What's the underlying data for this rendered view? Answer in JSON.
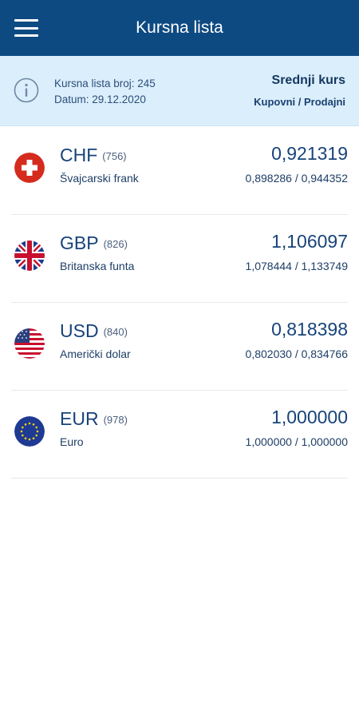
{
  "header": {
    "title": "Kursna lista"
  },
  "info": {
    "list_number": "Kursna lista broj: 245",
    "date": "Datum: 29.12.2020",
    "rate_title": "Srednji kurs",
    "rate_subtitle": "Kupovni / Prodajni"
  },
  "currencies": [
    {
      "code": "CHF",
      "number": "(756)",
      "name": "Švajcarski frank",
      "middle": "0,921319",
      "buy_sell": "0,898286 / 0,944352",
      "flag": "switzerland-flag-icon"
    },
    {
      "code": "GBP",
      "number": "(826)",
      "name": "Britanska funta",
      "middle": "1,106097",
      "buy_sell": "1,078444 / 1,133749",
      "flag": "uk-flag-icon"
    },
    {
      "code": "USD",
      "number": "(840)",
      "name": "Američki dolar",
      "middle": "0,818398",
      "buy_sell": "0,802030 / 0,834766",
      "flag": "usa-flag-icon"
    },
    {
      "code": "EUR",
      "number": "(978)",
      "name": "Euro",
      "middle": "1,000000",
      "buy_sell": "1,000000 / 1,000000",
      "flag": "eu-flag-icon"
    }
  ],
  "colors": {
    "appbar": "#0e4a82",
    "infobar": "#dbeefb",
    "text_primary": "#17437a"
  }
}
